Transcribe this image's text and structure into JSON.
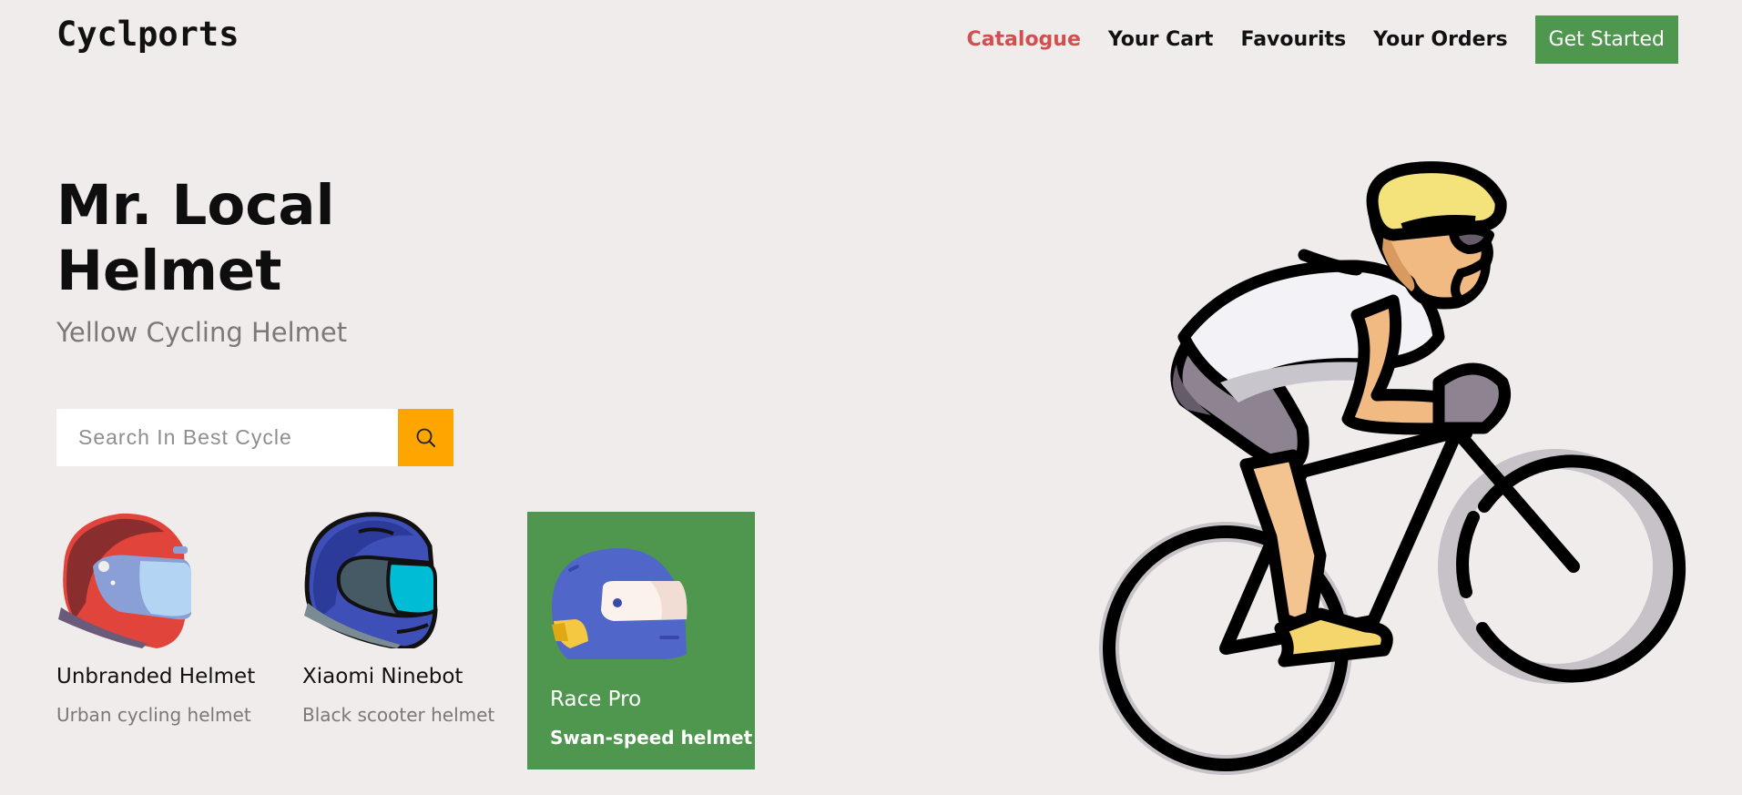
{
  "header": {
    "logo": "Cyclports",
    "nav": [
      {
        "label": "Catalogue",
        "active": true
      },
      {
        "label": "Your Cart",
        "active": false
      },
      {
        "label": "Favourits",
        "active": false
      },
      {
        "label": "Your Orders",
        "active": false
      }
    ],
    "cta_label": "Get Started"
  },
  "hero": {
    "title": "Mr. Local Helmet",
    "subtitle": "Yellow Cycling Helmet"
  },
  "search": {
    "placeholder": "Search In Best Cycle",
    "value": "",
    "icon": "search-icon"
  },
  "products": [
    {
      "name": "Unbranded Helmet",
      "description": "Urban cycling helmet",
      "icon": "red-motorcycle-helmet-icon",
      "selected": false
    },
    {
      "name": "Xiaomi Ninebot",
      "description": "Black scooter helmet",
      "icon": "blue-motorcycle-helmet-icon",
      "selected": false
    },
    {
      "name": "Race Pro",
      "description": "Swan-speed helmet",
      "icon": "blue-race-helmet-icon",
      "selected": true
    }
  ],
  "illustration": {
    "icon": "cyclist-illustration"
  },
  "colors": {
    "background": "#f0ecec",
    "accent_green": "#4f964f",
    "active_nav": "#d24f4f",
    "search_button": "#ffa500"
  }
}
